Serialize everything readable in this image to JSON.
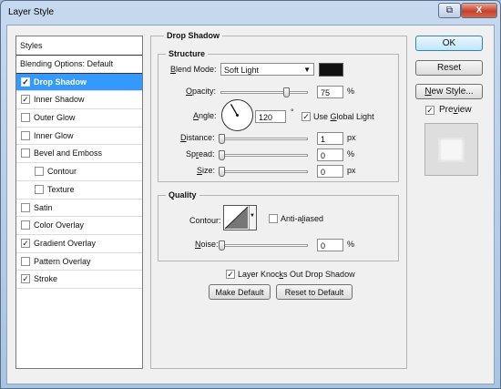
{
  "window": {
    "title": "Layer Style",
    "help_glyph": "⧉",
    "close_glyph": "X"
  },
  "styles_panel": {
    "header": "Styles",
    "items": [
      {
        "label": "Blending Options: Default",
        "checked": null,
        "selected": false,
        "indent": 0
      },
      {
        "label": "Drop Shadow",
        "checked": true,
        "selected": true,
        "indent": 1
      },
      {
        "label": "Inner Shadow",
        "checked": true,
        "selected": false,
        "indent": 1
      },
      {
        "label": "Outer Glow",
        "checked": false,
        "selected": false,
        "indent": 1
      },
      {
        "label": "Inner Glow",
        "checked": false,
        "selected": false,
        "indent": 1
      },
      {
        "label": "Bevel and Emboss",
        "checked": false,
        "selected": false,
        "indent": 1
      },
      {
        "label": "Contour",
        "checked": false,
        "selected": false,
        "indent": 2
      },
      {
        "label": "Texture",
        "checked": false,
        "selected": false,
        "indent": 2
      },
      {
        "label": "Satin",
        "checked": false,
        "selected": false,
        "indent": 1
      },
      {
        "label": "Color Overlay",
        "checked": false,
        "selected": false,
        "indent": 1
      },
      {
        "label": "Gradient Overlay",
        "checked": true,
        "selected": false,
        "indent": 1
      },
      {
        "label": "Pattern Overlay",
        "checked": false,
        "selected": false,
        "indent": 1
      },
      {
        "label": "Stroke",
        "checked": true,
        "selected": false,
        "indent": 1
      }
    ]
  },
  "drop_shadow": {
    "title": "Drop Shadow",
    "structure": {
      "title": "Structure",
      "blend_mode_label": "Blend Mode:",
      "blend_mode_value": "Soft Light",
      "shadow_color": "#111111",
      "opacity_label": "Opacity:",
      "opacity_value": "75",
      "opacity_unit": "%",
      "opacity_fraction": 0.75,
      "angle_label": "Angle:",
      "angle_value": "120",
      "angle_unit": "°",
      "angle_degrees": 120,
      "use_global_light_label": "Use Global Light",
      "use_global_light": true,
      "distance_label": "Distance:",
      "distance_value": "1",
      "distance_unit": "px",
      "distance_fraction": 0.0,
      "spread_label": "Spread:",
      "spread_value": "0",
      "spread_unit": "%",
      "spread_fraction": 0.0,
      "size_label": "Size:",
      "size_value": "0",
      "size_unit": "px",
      "size_fraction": 0.0
    },
    "quality": {
      "title": "Quality",
      "contour_label": "Contour:",
      "anti_aliased_label": "Anti-aliased",
      "anti_aliased": false,
      "noise_label": "Noise:",
      "noise_value": "0",
      "noise_unit": "%",
      "noise_fraction": 0.0
    },
    "knocks_out_label": "Layer Knocks Out Drop Shadow",
    "knocks_out": true,
    "make_default_label": "Make Default",
    "reset_default_label": "Reset to Default"
  },
  "buttons": {
    "ok": "OK",
    "reset": "Reset",
    "new_style": "New Style...",
    "preview_label": "Preview",
    "preview": true
  }
}
